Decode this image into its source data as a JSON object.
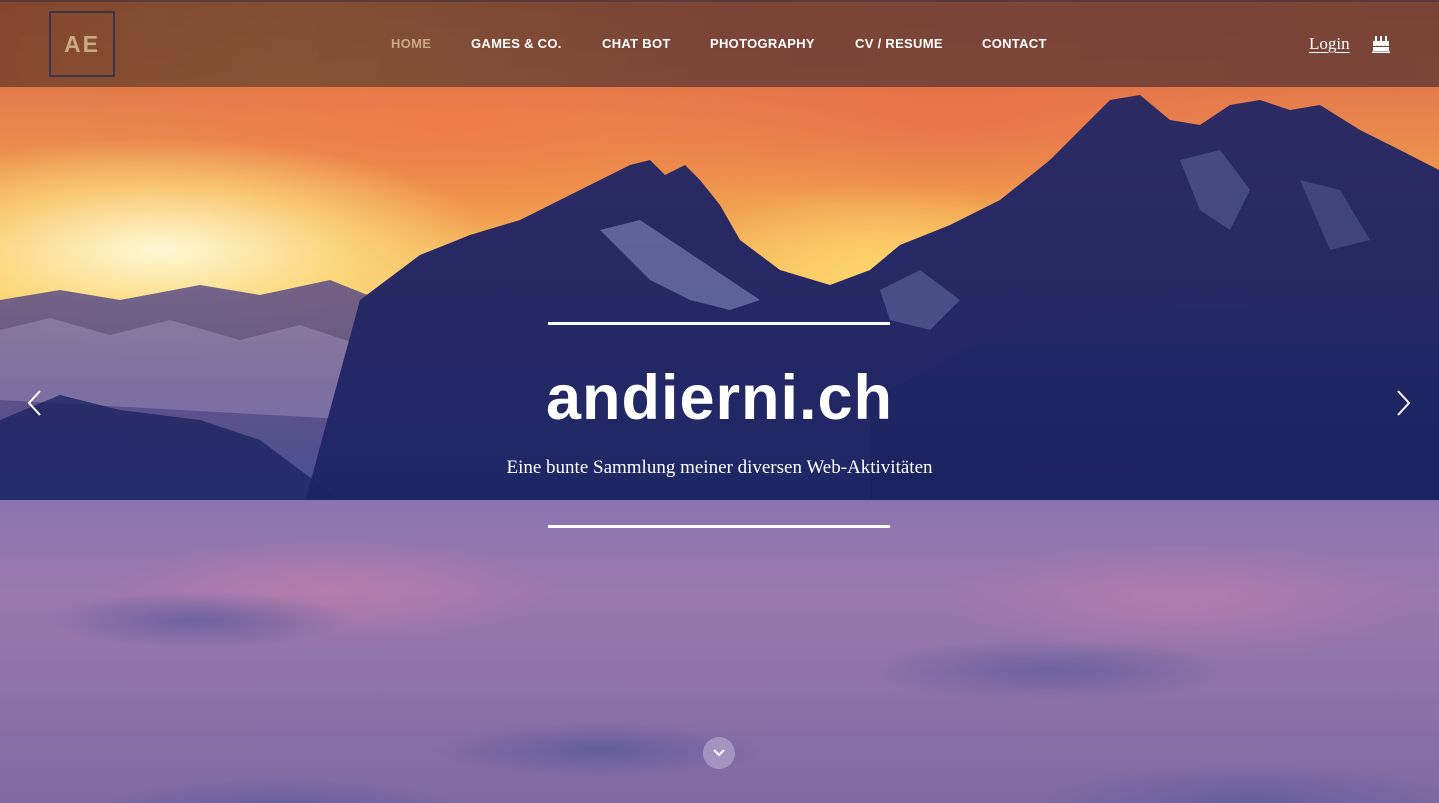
{
  "header": {
    "logo_text": "AE",
    "nav": [
      {
        "label": "HOME",
        "active": true
      },
      {
        "label": "GAMES & CO.",
        "active": false
      },
      {
        "label": "CHAT BOT",
        "active": false
      },
      {
        "label": "PHOTOGRAPHY",
        "active": false
      },
      {
        "label": "CV / RESUME",
        "active": false
      },
      {
        "label": "CONTACT",
        "active": false
      }
    ],
    "login_label": "Login",
    "extra_icon": "birthday-cake-icon"
  },
  "hero": {
    "title": "andierni.ch",
    "subtitle": "Eine bunte Sammlung meiner diversen Web-Aktivitäten",
    "prev_icon": "chevron-left-icon",
    "next_icon": "chevron-right-icon",
    "scroll_icon": "chevron-down-icon"
  },
  "colors": {
    "accent_active_nav": "#c8ab85",
    "text": "#ffffff"
  }
}
